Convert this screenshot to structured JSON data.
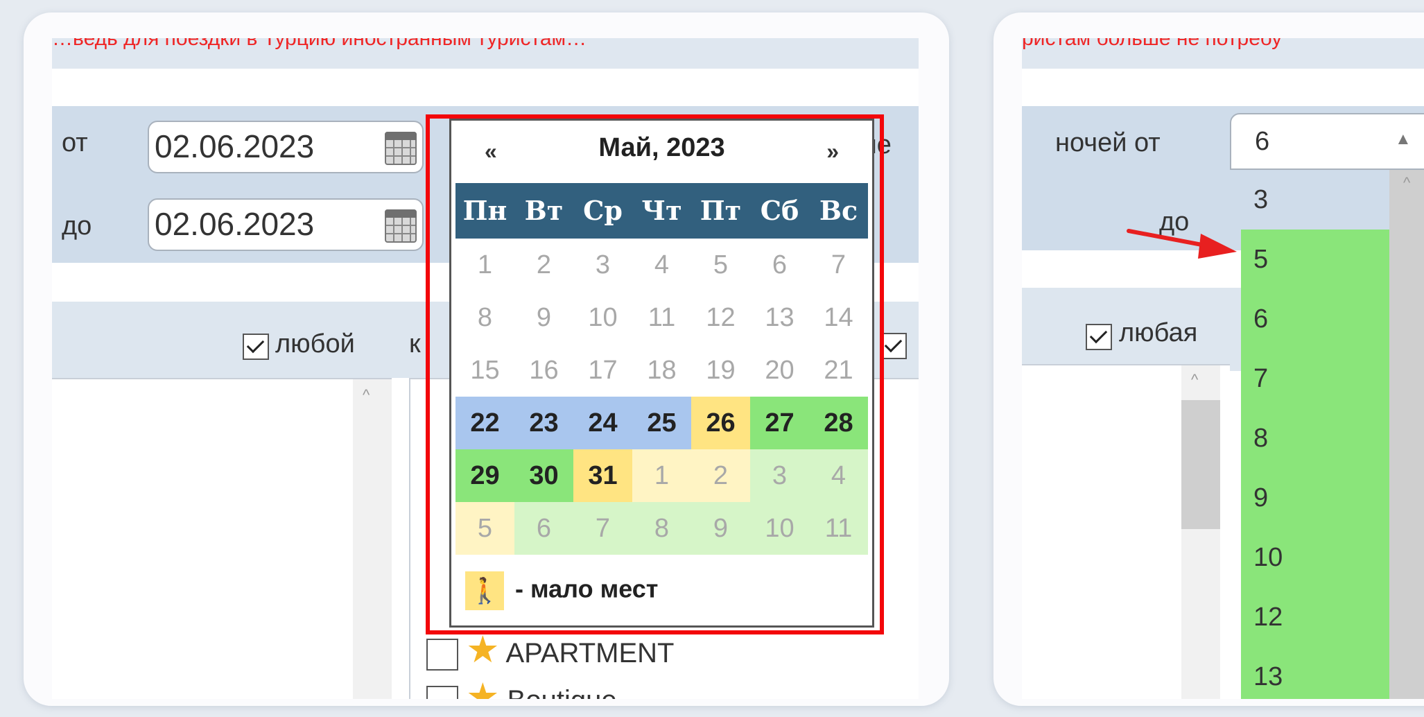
{
  "left": {
    "banner": "…ведь для поездки в Турцию иностранным туристам…",
    "date_from_label": "от",
    "date_to_label": "до",
    "date_from": "02.06.2023",
    "date_to": "02.06.2023",
    "any_label": "любой",
    "cut_label": "к",
    "cut_label2": "че",
    "calendar": {
      "prev": "«",
      "next": "»",
      "title": "Май, 2023",
      "weekdays": [
        "Пн",
        "Вт",
        "Ср",
        "Чт",
        "Пт",
        "Сб",
        "Вс"
      ],
      "rows": [
        [
          {
            "d": "1",
            "c": ""
          },
          {
            "d": "2",
            "c": ""
          },
          {
            "d": "3",
            "c": ""
          },
          {
            "d": "4",
            "c": ""
          },
          {
            "d": "5",
            "c": ""
          },
          {
            "d": "6",
            "c": ""
          },
          {
            "d": "7",
            "c": ""
          }
        ],
        [
          {
            "d": "8",
            "c": ""
          },
          {
            "d": "9",
            "c": ""
          },
          {
            "d": "10",
            "c": ""
          },
          {
            "d": "11",
            "c": ""
          },
          {
            "d": "12",
            "c": ""
          },
          {
            "d": "13",
            "c": ""
          },
          {
            "d": "14",
            "c": ""
          }
        ],
        [
          {
            "d": "15",
            "c": ""
          },
          {
            "d": "16",
            "c": ""
          },
          {
            "d": "17",
            "c": ""
          },
          {
            "d": "18",
            "c": ""
          },
          {
            "d": "19",
            "c": ""
          },
          {
            "d": "20",
            "c": ""
          },
          {
            "d": "21",
            "c": ""
          }
        ],
        [
          {
            "d": "22",
            "c": "c-blue b"
          },
          {
            "d": "23",
            "c": "c-blue b"
          },
          {
            "d": "24",
            "c": "c-blue b"
          },
          {
            "d": "25",
            "c": "c-blue b"
          },
          {
            "d": "26",
            "c": "c-yellow b"
          },
          {
            "d": "27",
            "c": "c-green b"
          },
          {
            "d": "28",
            "c": "c-green b"
          }
        ],
        [
          {
            "d": "29",
            "c": "c-green b"
          },
          {
            "d": "30",
            "c": "c-green b"
          },
          {
            "d": "31",
            "c": "c-yellow b"
          },
          {
            "d": "1",
            "c": "c-lyellow"
          },
          {
            "d": "2",
            "c": "c-lyellow"
          },
          {
            "d": "3",
            "c": "c-lgreen"
          },
          {
            "d": "4",
            "c": "c-lgreen"
          }
        ],
        [
          {
            "d": "5",
            "c": "c-lyellow"
          },
          {
            "d": "6",
            "c": "c-lgreen"
          },
          {
            "d": "7",
            "c": "c-lgreen"
          },
          {
            "d": "8",
            "c": "c-lgreen"
          },
          {
            "d": "9",
            "c": "c-lgreen"
          },
          {
            "d": "10",
            "c": "c-lgreen"
          },
          {
            "d": "11",
            "c": "c-lgreen"
          }
        ]
      ],
      "legend_text": "- мало мест"
    },
    "hotels": [
      "APARTMENT",
      "Boutique"
    ]
  },
  "right": {
    "banner": "ристам больше не потребу",
    "nights_from_label": "ночей от",
    "nights_to_label": "до",
    "any_label": "любая",
    "selected": "6",
    "options": [
      {
        "v": "3",
        "available": false
      },
      {
        "v": "5",
        "available": true
      },
      {
        "v": "6",
        "available": true
      },
      {
        "v": "7",
        "available": true
      },
      {
        "v": "8",
        "available": true
      },
      {
        "v": "9",
        "available": true
      },
      {
        "v": "10",
        "available": true
      },
      {
        "v": "12",
        "available": true
      },
      {
        "v": "13",
        "available": true
      }
    ]
  },
  "colors": {
    "highlight_border": "#f3060a",
    "available": "#8ae57a",
    "few_places": "#ffe482",
    "selected_range": "#a9c6ee",
    "header": "#32607e"
  }
}
